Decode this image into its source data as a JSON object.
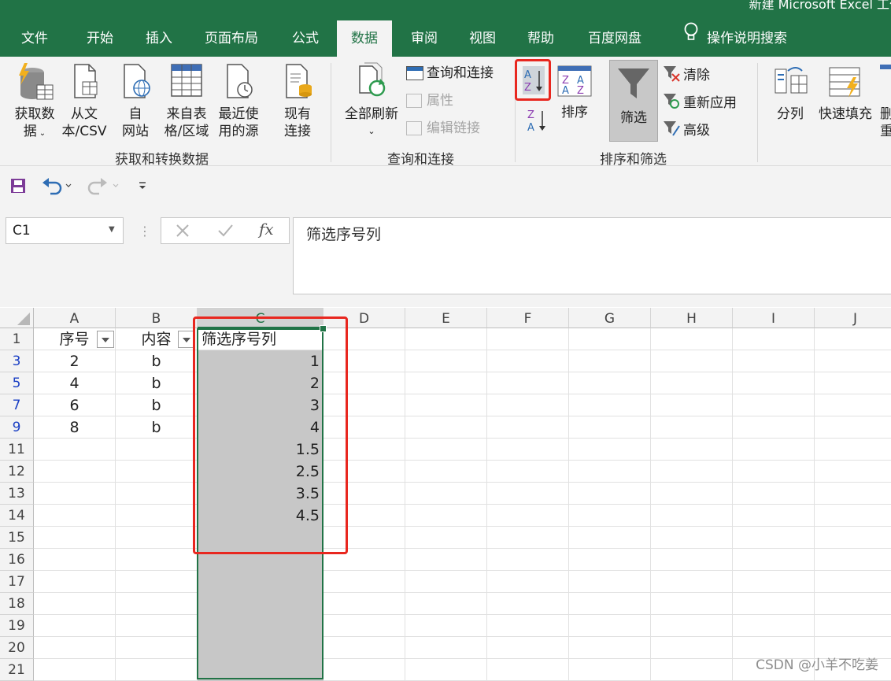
{
  "window": {
    "title": "新建 Microsoft Excel 工作表"
  },
  "tabs": [
    "文件",
    "开始",
    "插入",
    "页面布局",
    "公式",
    "数据",
    "审阅",
    "视图",
    "帮助",
    "百度网盘"
  ],
  "tell_me": "操作说明搜索",
  "ribbon": {
    "get_data_line1": "获取数",
    "get_data_line2": "据",
    "from_text_line1": "从文",
    "from_text_line2": "本/CSV",
    "from_web_line1": "自",
    "from_web_line2": "网站",
    "from_table_line1": "来自表",
    "from_table_line2": "格/区域",
    "recent_line1": "最近使",
    "recent_line2": "用的源",
    "existing_line1": "现有",
    "existing_line2": "连接",
    "group_get": "获取和转换数据",
    "refresh_all": "全部刷新",
    "queries_connections": "查询和连接",
    "properties": "属性",
    "edit_links": "编辑链接",
    "group_queries": "查询和连接",
    "sort": "排序",
    "filter": "筛选",
    "clear": "清除",
    "reapply": "重新应用",
    "advanced": "高级",
    "group_sort": "排序和筛选",
    "text_to_columns": "分列",
    "flash_fill": "快速填充",
    "cut_off_1": "删",
    "cut_off_2": "重"
  },
  "formula_bar": {
    "namebox": "C1",
    "fx": "fx",
    "content": "筛选序号列"
  },
  "columns": [
    "A",
    "B",
    "C",
    "D",
    "E",
    "F",
    "G",
    "H",
    "I",
    "J"
  ],
  "rows": [
    {
      "num": "1",
      "a": "序号",
      "b": "内容",
      "c": "筛选序号列",
      "filtered": false,
      "header": true
    },
    {
      "num": "3",
      "a": "2",
      "b": "b",
      "c": "1",
      "filtered": true
    },
    {
      "num": "5",
      "a": "4",
      "b": "b",
      "c": "2",
      "filtered": true
    },
    {
      "num": "7",
      "a": "6",
      "b": "b",
      "c": "3",
      "filtered": true
    },
    {
      "num": "9",
      "a": "8",
      "b": "b",
      "c": "4",
      "filtered": true
    },
    {
      "num": "11",
      "a": "",
      "b": "",
      "c": "1.5",
      "filtered": false
    },
    {
      "num": "12",
      "a": "",
      "b": "",
      "c": "2.5",
      "filtered": false
    },
    {
      "num": "13",
      "a": "",
      "b": "",
      "c": "3.5",
      "filtered": false
    },
    {
      "num": "14",
      "a": "",
      "b": "",
      "c": "4.5",
      "filtered": false
    },
    {
      "num": "15",
      "a": "",
      "b": "",
      "c": "",
      "filtered": false
    },
    {
      "num": "16",
      "a": "",
      "b": "",
      "c": "",
      "filtered": false
    },
    {
      "num": "17",
      "a": "",
      "b": "",
      "c": "",
      "filtered": false
    },
    {
      "num": "18",
      "a": "",
      "b": "",
      "c": "",
      "filtered": false
    },
    {
      "num": "19",
      "a": "",
      "b": "",
      "c": "",
      "filtered": false
    },
    {
      "num": "20",
      "a": "",
      "b": "",
      "c": "",
      "filtered": false
    },
    {
      "num": "21",
      "a": "",
      "b": "",
      "c": "",
      "filtered": false
    }
  ],
  "colors": {
    "excel_green": "#217346",
    "highlight_red": "#e8271f",
    "selection_gray": "#c7c7c7"
  },
  "watermark": "CSDN @小羊不吃姜"
}
